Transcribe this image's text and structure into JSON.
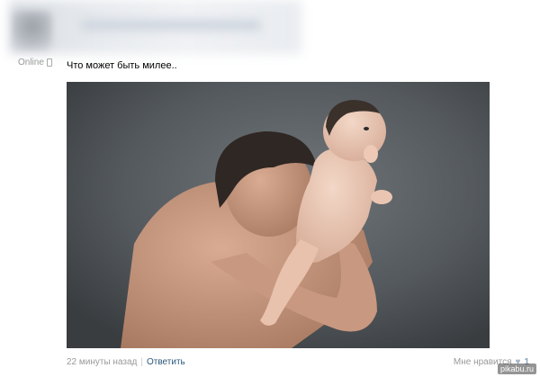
{
  "status": {
    "online_label": "Online",
    "icon": "mobile-phone-icon"
  },
  "message": {
    "text": "Что может быть милее.."
  },
  "photo": {
    "subject": "photo"
  },
  "footer": {
    "timestamp": "22 минуты назад",
    "separator": "|",
    "reply_label": "Ответить",
    "like_label": "Мне нравится",
    "like_icon": "heart-icon",
    "like_count": "1"
  },
  "watermark": {
    "text": "pikabu.ru"
  },
  "colors": {
    "link": "#2b587a",
    "muted": "#999999"
  }
}
